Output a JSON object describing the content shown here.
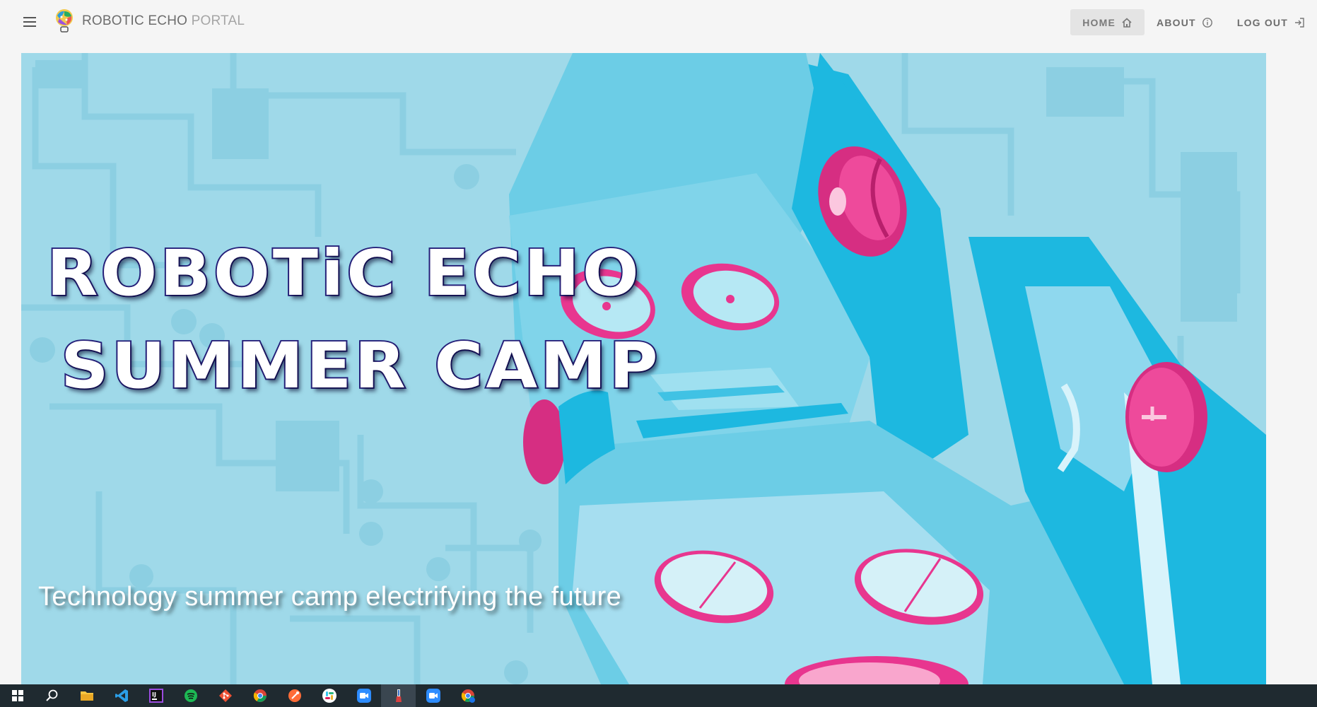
{
  "header": {
    "title_part1": "ROBOTIC ECHO",
    "title_part2": "PORTAL",
    "menu_icon": "hamburger-menu-icon",
    "logo_icon": "brain-lightbulb-logo"
  },
  "nav": {
    "items": [
      {
        "label": "HOME",
        "icon": "home-icon",
        "active": true
      },
      {
        "label": "ABOUT",
        "icon": "info-icon",
        "active": false
      },
      {
        "label": "LOG OUT",
        "icon": "logout-icon",
        "active": false
      }
    ]
  },
  "hero": {
    "title_line1": "ROBOTiC ECHO",
    "title_line2": "SUMMER CAMP",
    "tagline": "Technology summer camp electrifying the future",
    "colors": {
      "background": "#9fd9e9",
      "robot_blue": "#1db8e0",
      "robot_light": "#6ccde6",
      "accent_pink": "#e8368f",
      "title_outline": "#26207a"
    }
  },
  "taskbar": {
    "apps": [
      {
        "name": "start",
        "icon": "windows-start-icon",
        "active": false
      },
      {
        "name": "search",
        "icon": "search-icon",
        "active": false
      },
      {
        "name": "file-explorer",
        "icon": "folder-icon",
        "active": false
      },
      {
        "name": "vscode",
        "icon": "vscode-icon",
        "active": false
      },
      {
        "name": "intellij",
        "icon": "intellij-icon",
        "active": false
      },
      {
        "name": "spotify",
        "icon": "spotify-icon",
        "active": false
      },
      {
        "name": "git",
        "icon": "git-icon",
        "active": false
      },
      {
        "name": "chrome",
        "icon": "chrome-icon",
        "active": false
      },
      {
        "name": "postman",
        "icon": "postman-icon",
        "active": false
      },
      {
        "name": "slack",
        "icon": "slack-icon",
        "active": false
      },
      {
        "name": "zoom",
        "icon": "zoom-icon",
        "active": false
      },
      {
        "name": "paint",
        "icon": "paint-icon",
        "active": true
      },
      {
        "name": "zoom-2",
        "icon": "zoom-icon",
        "active": false
      },
      {
        "name": "chrome-canary",
        "icon": "chrome-alt-icon",
        "active": false
      }
    ]
  }
}
